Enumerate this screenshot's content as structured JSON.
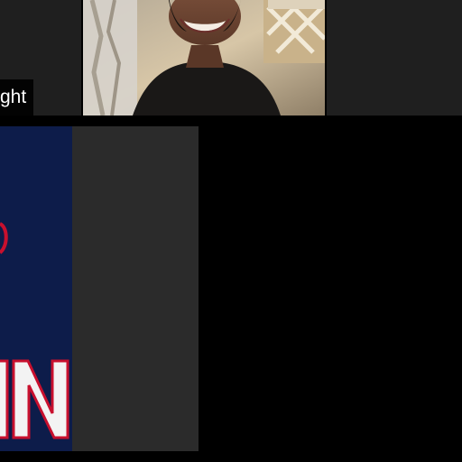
{
  "participants": {
    "top_left": {
      "name_fragment": "ght"
    }
  },
  "colors": {
    "background": "#000000",
    "tile_dark": "#1f1f1f",
    "tile_gray": "#2b2b2b",
    "shared_screen_navy": "#0d1c4a",
    "shared_screen_red": "#c8102e"
  },
  "shared_screen": {
    "visible_text": "N"
  }
}
